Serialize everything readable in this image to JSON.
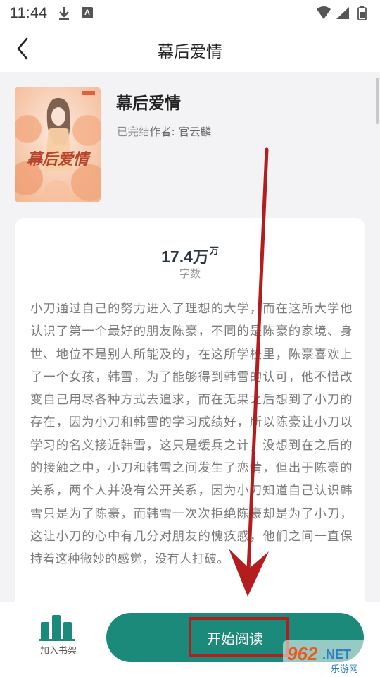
{
  "status_bar": {
    "time": "11:44",
    "icons": [
      "download-icon",
      "font-a-icon",
      "wifi-icon",
      "signal-icon",
      "battery-icon"
    ],
    "a_glyph": "A"
  },
  "header": {
    "title": "幕后爱情",
    "back_icon": "chevron-left-icon"
  },
  "book": {
    "title": "幕后爱情",
    "status": "已完结",
    "author_label": "作者: 官云麟",
    "cover_title": "幕后爱情"
  },
  "stats": {
    "word_count": "17.4万",
    "word_unit": "万",
    "word_label": "字数"
  },
  "synopsis": "小刀通过自己的努力进入了理想的大学，而在这所大学他认识了第一个最好的朋友陈豪，不同的是陈豪的家境、身世、地位不是别人所能及的，在这所学校里，陈豪喜欢上了一个女孩，韩雪，为了能够得到韩雪的认可，他不惜改变自己用尽各种方式去追求，而在无果之后想到了小刀的存在，因为小刀和韩雪的学习成绩好，所以陈豪让小刀以学习的名义接近韩雪，这只是缓兵之计，没想到在之后的的接触之中，小刀和韩雪之间发生了恋情，但出于陈豪的关系，两个人并没有公开关系，因为小刀知道自己认识韩雪只是为了陈豪，而韩雪一次次拒绝陈豪却是为了小刀，这让小刀的心中有几分对朋友的愧疚感，他们之间一直保持着这种微妙的感觉，没有人打破。",
  "bottom": {
    "shelf_label": "加入书架",
    "read_label": "开始阅读"
  },
  "watermark": {
    "brand": "962",
    "suffix": ".NET",
    "sub": "乐游网"
  },
  "colors": {
    "accent": "#1b8a7a",
    "annotation": "#b31d1d"
  }
}
